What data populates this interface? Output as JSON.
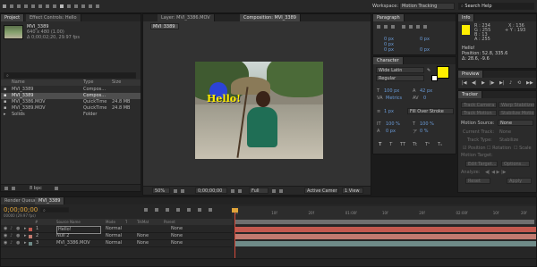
{
  "topbar": {
    "workspace_label": "Workspace:",
    "workspace_value": "Motion Tracking",
    "search_placeholder": "Search Help"
  },
  "project": {
    "tabs": [
      "Project",
      "Effect Controls: Hello"
    ],
    "selected_name": "MVI_3389",
    "selected_info1": "640 x 480 (1.00)",
    "selected_info2": "Δ 0;00;02;20, 29.97 fps",
    "search_value": "",
    "columns": [
      "Name",
      "Type",
      "Size"
    ],
    "items": [
      {
        "name": "MVI_3389",
        "type": "Compos...",
        "size": ""
      },
      {
        "name": "MVI_3389",
        "type": "Compos...",
        "size": ""
      },
      {
        "name": "MVI_3386.MOV",
        "type": "QuickTime",
        "size": "24.8 MB"
      },
      {
        "name": "MVI_3389.MOV",
        "type": "QuickTime",
        "size": "24.8 MB"
      },
      {
        "name": "Solids",
        "type": "Folder",
        "size": ""
      }
    ],
    "footer_bpc": "8 bpc"
  },
  "viewer": {
    "tabs": [
      "Layer: MVI_3386.MOV",
      "Composition: MVI_3389"
    ],
    "comp_label": "MVI_3389",
    "overlay_text": "Hello!",
    "zoom": "50%",
    "timecode": "0;00;00;00",
    "resolution": "Full",
    "camera": "Active Camera",
    "views": "1 View"
  },
  "paragraph": {
    "tab": "Paragraph",
    "fields": [
      "0 px",
      "0 px",
      "0 px",
      "0 px",
      "0 px"
    ]
  },
  "character": {
    "tab": "Character",
    "font": "Wide Latin",
    "style": "Regular",
    "size": "100 px",
    "leading": "42 px",
    "kerning": "Metrics",
    "tracking": "0",
    "stroke": "1 px",
    "stroke_type": "Fill Over Stroke",
    "vscale": "100 %",
    "hscale": "100 %",
    "baseline": "0 px",
    "tsume": "0 %",
    "fill_color": "#ffee00",
    "style_buttons": [
      "T",
      "T",
      "TT",
      "Tt",
      "T¹",
      "T₁"
    ]
  },
  "info": {
    "tab": "Info",
    "r": "R : 234",
    "g": "G : 255",
    "b": "B : 13",
    "a": "A : 255",
    "x": "X : 136",
    "y": "+ Y : 193",
    "layer": "Hello!",
    "position": "Position: 52.8, 335.6",
    "delta": "Δ: 28.6, -9.6"
  },
  "preview": {
    "tab": "Preview",
    "controls": [
      "first-frame",
      "prev-frame",
      "play",
      "next-frame",
      "last-frame",
      "audio",
      "loop",
      "ram-preview"
    ]
  },
  "tracker": {
    "tab": "Tracker",
    "buttons": [
      "Track Camera",
      "Warp Stabilizer",
      "Track Motion",
      "Stabilize Motion"
    ],
    "motion_source_label": "Motion Source:",
    "motion_source_value": "None",
    "current_track_label": "Current Track:",
    "current_track_value": "None",
    "track_type_label": "Track Type:",
    "track_type_value": "Stabilize",
    "checkboxes": [
      "Position",
      "Rotation",
      "Scale"
    ],
    "motion_target_label": "Motion Target:",
    "edit_target": "Edit Target...",
    "options": "Options...",
    "analyze_label": "Analyze:",
    "reset": "Reset",
    "apply": "Apply"
  },
  "timeline": {
    "tabs": [
      "Render Queue",
      "MVI_3389"
    ],
    "timecode": "0;00;00;00",
    "timecode_sub": "00000 (29.97 fps)",
    "search_value": "",
    "columns": [
      "#",
      "Source Name",
      "Mode",
      "T",
      "TrkMat",
      "Parent"
    ],
    "layers": [
      {
        "num": "1",
        "name": "Hello!",
        "mode": "Normal",
        "trkmat": "",
        "parent": "None",
        "color": "#c4594f"
      },
      {
        "num": "2",
        "name": "Null 2",
        "mode": "Normal",
        "trkmat": "None",
        "parent": "None",
        "color": "#c27a6f"
      },
      {
        "num": "3",
        "name": "MVI_3386.MOV",
        "mode": "Normal",
        "trkmat": "None",
        "parent": "None",
        "color": "#6f8b88"
      }
    ],
    "ruler": [
      "0f",
      "10f",
      "20f",
      "01:00f",
      "10f",
      "20f",
      "02:00f",
      "10f",
      "20f"
    ]
  }
}
